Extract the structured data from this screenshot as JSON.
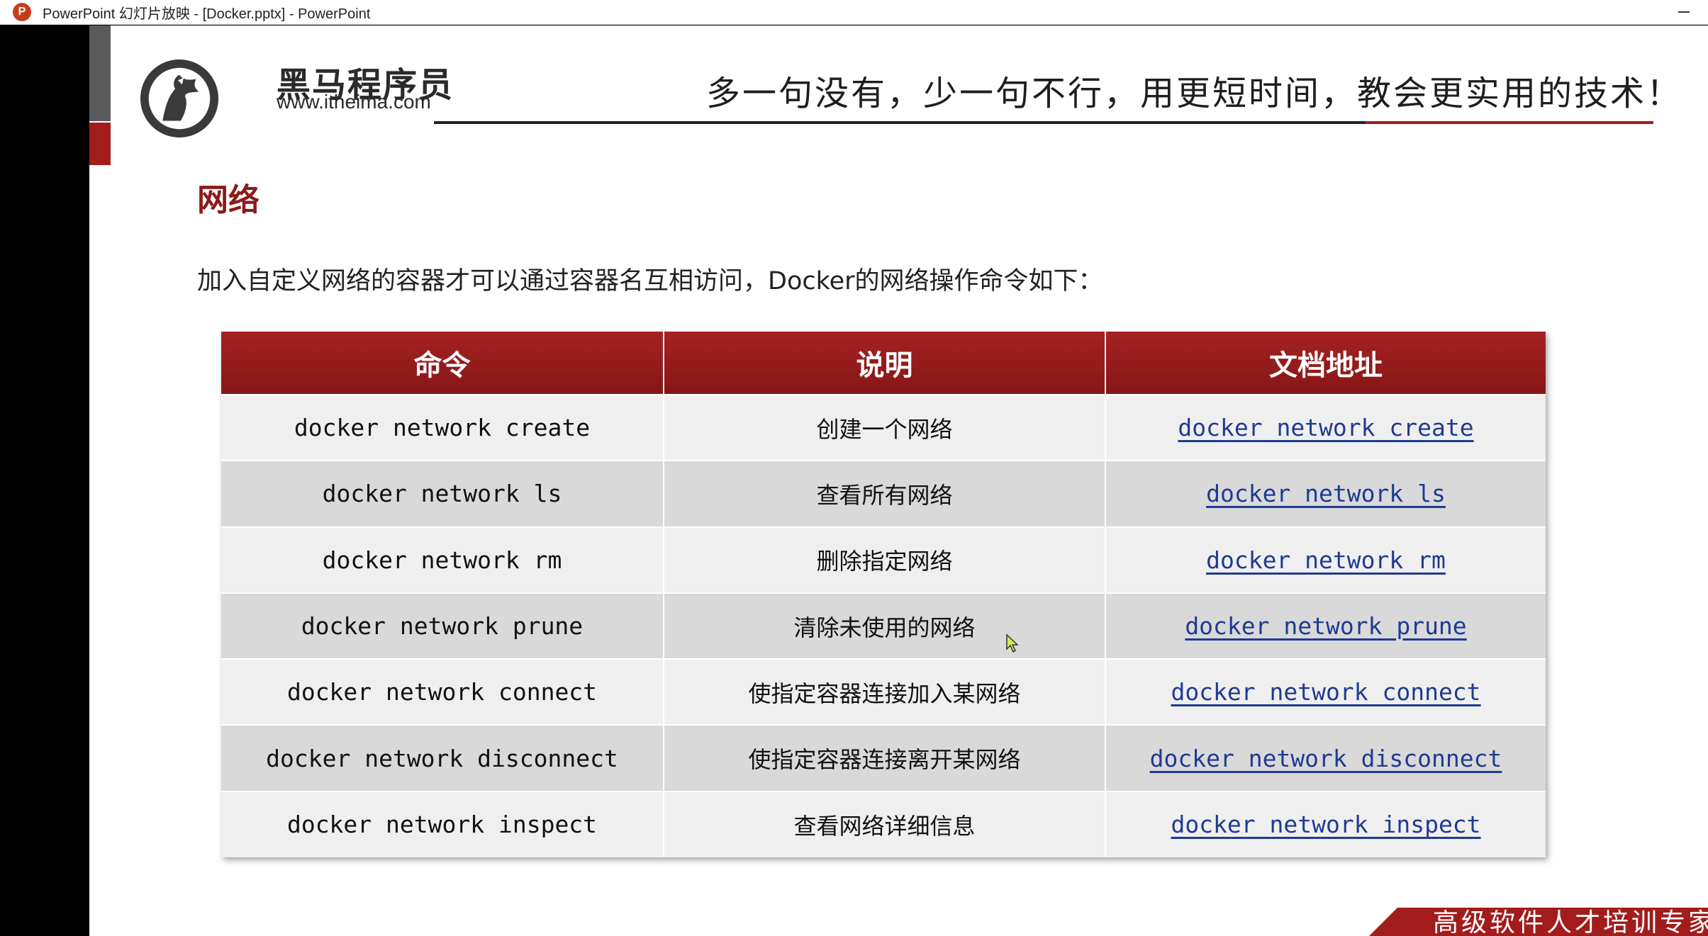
{
  "window": {
    "app_icon_letter": "P",
    "title": "PowerPoint 幻灯片放映 - [Docker.pptx] - PowerPoint"
  },
  "slide": {
    "brand": {
      "name": "黑马程序员",
      "url": "www.itheima.com"
    },
    "slogan": "多一句没有，少一句不行，用更短时间，教会更实用的技术！",
    "section_title": "网络",
    "intro": "加入自定义网络的容器才可以通过容器名互相访问，Docker的网络操作命令如下：",
    "table": {
      "headers": [
        "命令",
        "说明",
        "文档地址"
      ],
      "rows": [
        {
          "command": "docker network create",
          "description": "创建一个网络",
          "doc": "docker network create"
        },
        {
          "command": "docker network ls",
          "description": "查看所有网络",
          "doc": "docker network ls"
        },
        {
          "command": "docker network rm",
          "description": "删除指定网络",
          "doc": "docker network rm"
        },
        {
          "command": "docker network prune",
          "description": "清除未使用的网络",
          "doc": "docker network prune"
        },
        {
          "command": "docker network connect",
          "description": "使指定容器连接加入某网络",
          "doc": "docker network connect"
        },
        {
          "command": "docker network disconnect",
          "description": "使指定容器连接离开某网络",
          "doc": "docker network disconnect"
        },
        {
          "command": "docker network inspect",
          "description": "查看网络详细信息",
          "doc": "docker network inspect"
        }
      ]
    },
    "footer": "高级软件人才培训专家"
  },
  "colors": {
    "accent_red": "#a31c1c",
    "link_blue": "#1f3a93"
  }
}
